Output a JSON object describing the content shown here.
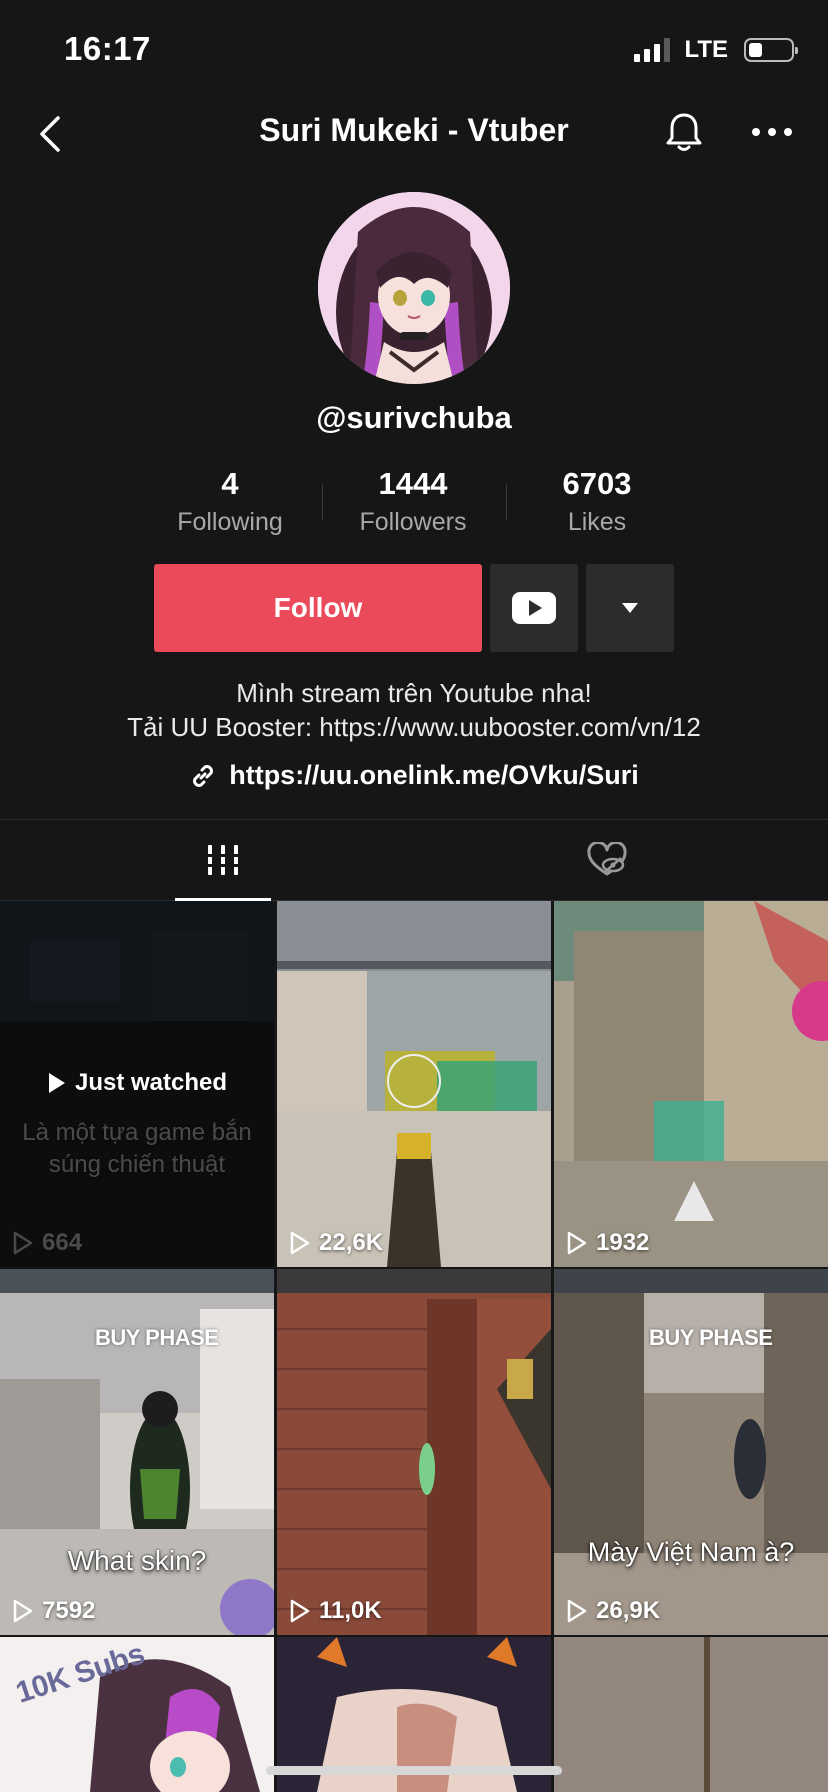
{
  "status_bar": {
    "time": "16:17",
    "network": "LTE"
  },
  "header": {
    "title": "Suri Mukeki - Vtuber"
  },
  "profile": {
    "username": "@surivchuba",
    "stats": [
      {
        "value": "4",
        "label": "Following"
      },
      {
        "value": "1444",
        "label": "Followers"
      },
      {
        "value": "6703",
        "label": "Likes"
      }
    ],
    "follow_label": "Follow",
    "bio_line1": "Mình stream trên Youtube nha!",
    "bio_line2": "Tải UU Booster: https://www.uubooster.com/vn/12",
    "link": "https://uu.onelink.me/OVku/Suri"
  },
  "tabs": [
    {
      "icon": "grid-icon",
      "active": true
    },
    {
      "icon": "liked-hidden-icon",
      "active": false
    }
  ],
  "videos": [
    {
      "views": "664",
      "caption": "Là một tựa game bắn súng chiến thuật",
      "overlay": "Just watched",
      "watched": true
    },
    {
      "views": "22,6K",
      "caption": ""
    },
    {
      "views": "1932",
      "caption": ""
    },
    {
      "views": "7592",
      "caption": "What skin?",
      "badge": "BUY PHASE"
    },
    {
      "views": "11,0K",
      "caption": ""
    },
    {
      "views": "26,9K",
      "caption": "Mày Việt Nam à?",
      "badge": "BUY PHASE"
    },
    {
      "views": "",
      "caption": "",
      "badge": "10K Subs"
    },
    {
      "views": "",
      "caption": ""
    },
    {
      "views": "",
      "caption": ""
    }
  ],
  "colors": {
    "accent": "#ea4a5a",
    "background": "#161616",
    "button_dark": "#2c2c2c"
  }
}
